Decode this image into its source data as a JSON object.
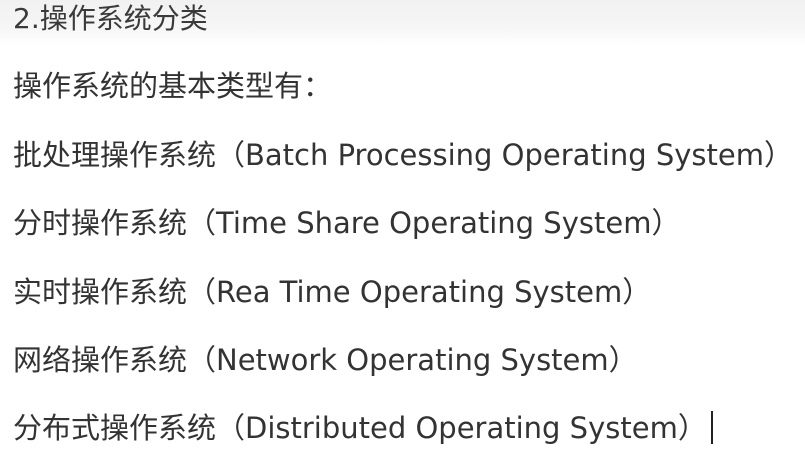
{
  "document": {
    "heading": "2.操作系统分类",
    "intro": "操作系统的基本类型有：",
    "items": [
      "批处理操作系统（Batch Processing Operating System）",
      "分时操作系统（Time Share Operating System）",
      "实时操作系统（Rea Time Operating System）",
      "网络操作系统（Network Operating System）",
      "分布式操作系统（Distributed Operating System）"
    ]
  }
}
